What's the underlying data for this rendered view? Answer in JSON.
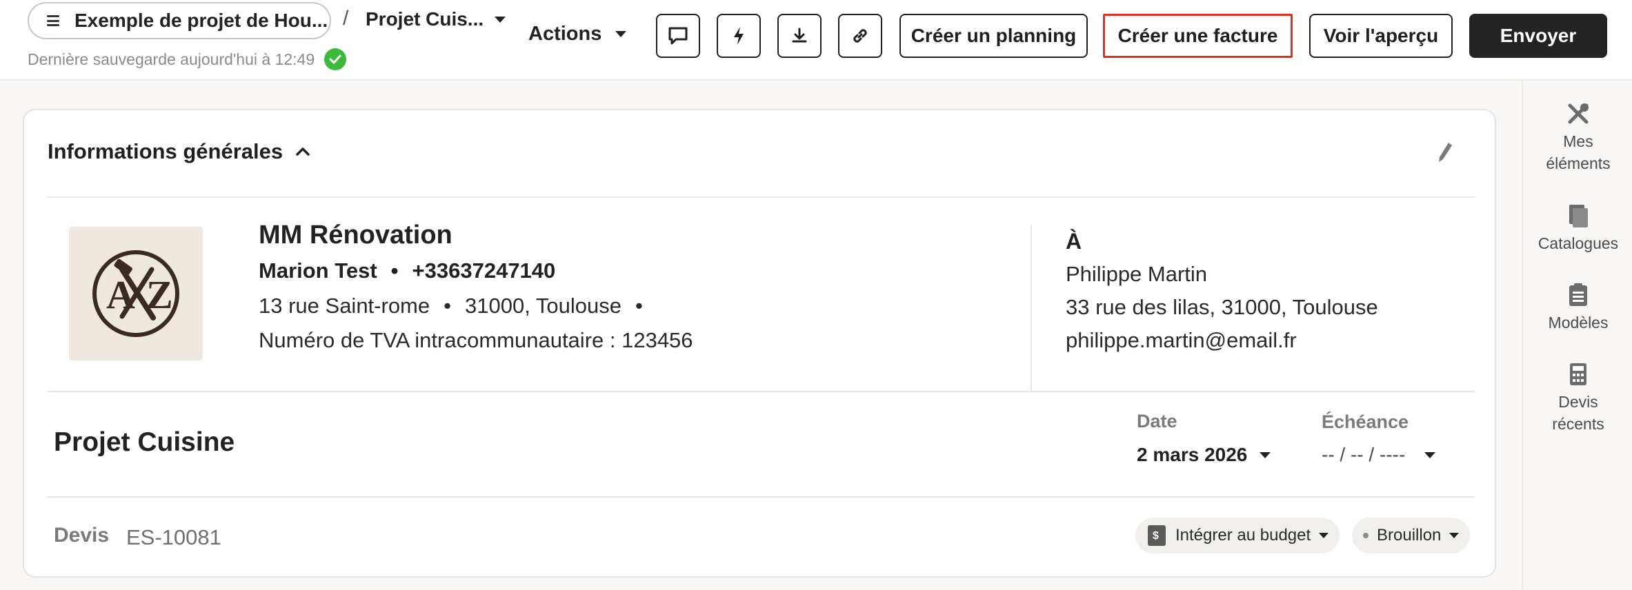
{
  "header": {
    "project_pill": "Exemple de projet de Hou...",
    "breadcrumb_separator": "/",
    "current_project": "Projet Cuis...",
    "save_status": "Dernière sauvegarde aujourd'hui à 12:49",
    "actions_label": "Actions",
    "buttons": {
      "create_planning": "Créer un planning",
      "create_invoice": "Créer une facture",
      "preview": "Voir l'aperçu",
      "send": "Envoyer"
    }
  },
  "sidebar": {
    "items": [
      {
        "label_line1": "Mes",
        "label_line2": "éléments",
        "icon": "tools-icon"
      },
      {
        "label_line1": "Catalogues",
        "label_line2": "",
        "icon": "book-icon"
      },
      {
        "label_line1": "Modèles",
        "label_line2": "",
        "icon": "clipboard-icon"
      },
      {
        "label_line1": "Devis",
        "label_line2": "récents",
        "icon": "calculator-icon"
      }
    ]
  },
  "general_info": {
    "title": "Informations générales",
    "company": {
      "name": "MM Rénovation",
      "contact_name": "Marion Test",
      "bullet": "•",
      "phone": "+33637247140",
      "street": "13 rue Saint-rome",
      "city": "31000, Toulouse",
      "vat": "Numéro de TVA intracommunautaire : 123456"
    },
    "client": {
      "to_label": "À",
      "name": "Philippe Martin",
      "address": "33 rue des lilas, 31000, Toulouse",
      "email": "philippe.martin@email.fr"
    }
  },
  "project": {
    "title": "Projet Cuisine",
    "date_label": "Date",
    "date_value": "2 mars 2026",
    "due_label": "Échéance",
    "due_value": "-- / -- / ----"
  },
  "document": {
    "type_label": "Devis",
    "number": "ES-10081",
    "budget_label": "Intégrer au budget",
    "status_label": "Brouillon"
  }
}
